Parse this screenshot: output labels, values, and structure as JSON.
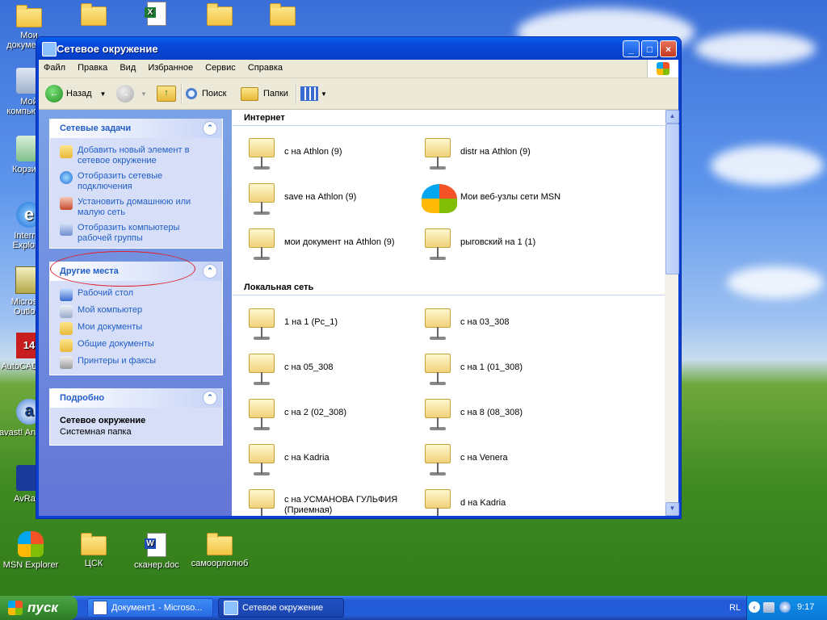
{
  "desktop": {
    "icons": [
      {
        "label": "Мои документы",
        "kind": "folder"
      },
      {
        "label": "Мой компьютер",
        "kind": "computer"
      },
      {
        "label": "Корзина",
        "kind": "recycle"
      },
      {
        "label": "Internet Explorer",
        "kind": "ie"
      },
      {
        "label": "Microsoft Outlook",
        "kind": "outlook"
      },
      {
        "label": "AutoCAD R14",
        "kind": "autocad"
      },
      {
        "label": "avast! Antivirus",
        "kind": "avast"
      },
      {
        "label": "AvRack",
        "kind": "app"
      },
      {
        "label": "MSN Explorer",
        "kind": "msn"
      },
      {
        "label": "ЦСК",
        "kind": "folder"
      },
      {
        "label": "сканер.doc",
        "kind": "word-doc"
      },
      {
        "label": "самоорлолюб",
        "kind": "folder"
      }
    ],
    "top_icons": [
      {
        "label": "",
        "kind": "folder"
      },
      {
        "label": "",
        "kind": "folder"
      },
      {
        "label": "",
        "kind": "excel-doc"
      },
      {
        "label": "",
        "kind": "folder"
      },
      {
        "label": "",
        "kind": "folder"
      }
    ]
  },
  "window": {
    "title": "Сетевое окружение",
    "controls": {
      "minimize": "_",
      "maximize": "□",
      "close": "×"
    },
    "menu": [
      "Файл",
      "Правка",
      "Вид",
      "Избранное",
      "Сервис",
      "Справка"
    ],
    "toolbar": {
      "back": "Назад",
      "search": "Поиск",
      "folders": "Папки"
    },
    "sidebar": {
      "network_tasks": {
        "title": "Сетевые задачи",
        "items": [
          "Добавить новый элемент в сетевое окружение",
          "Отобразить сетевые подключения",
          "Установить домашнюю или малую сеть",
          "Отобразить компьютеры рабочей группы"
        ]
      },
      "other_places": {
        "title": "Другие места",
        "items": [
          "Рабочий стол",
          "Мой компьютер",
          "Мои документы",
          "Общие документы",
          "Принтеры и факсы"
        ]
      },
      "details": {
        "title": "Подробно",
        "name": "Сетевое окружение",
        "type": "Системная папка"
      }
    },
    "groups": [
      {
        "title": "Интернет",
        "items": [
          "с на Athlon (9)",
          "distr на Athlon (9)",
          "save на Athlon (9)",
          "Мои веб-узлы сети MSN",
          "мои документ на Athlon (9)",
          "рыговский на 1 (1)"
        ]
      },
      {
        "title": "Локальная сеть",
        "items": [
          "1 на 1 (Pc_1)",
          "c на 03_308",
          "c на 05_308",
          "c на 1 (01_308)",
          "c на 2 (02_308)",
          "c на 8 (08_308)",
          "c на Kadria",
          "c на Venera",
          "c на УСМАНОВА ГУЛЬФИЯ (Приемная)",
          "d на Kadria"
        ]
      }
    ]
  },
  "taskbar": {
    "start": "пуск",
    "tasks": [
      "Документ1 - Microso...",
      "Сетевое окружение"
    ],
    "tray": {
      "lang": "RL",
      "clock": "9:17"
    }
  }
}
